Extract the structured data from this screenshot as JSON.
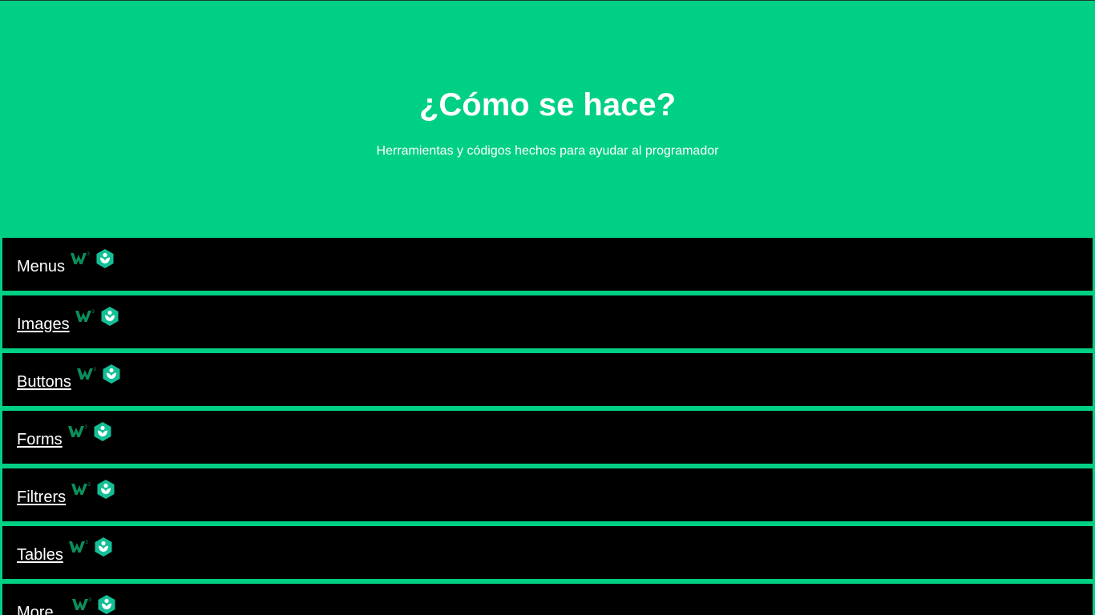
{
  "hero": {
    "title": "¿Cómo se hace?",
    "subtitle": "Herramientas y códigos hechos para ayudar al programador"
  },
  "colors": {
    "background": "#00d084",
    "row_background": "#000000",
    "text": "#ffffff",
    "w3_icon": "#0a8f5c",
    "ka_icon": "#14bf96"
  },
  "items": [
    {
      "label": "Menus",
      "link": false,
      "icons": [
        "w3schools-icon",
        "khan-academy-icon"
      ]
    },
    {
      "label": "Images",
      "link": true,
      "icons": [
        "w3schools-icon",
        "khan-academy-icon"
      ]
    },
    {
      "label": "Buttons",
      "link": true,
      "icons": [
        "w3schools-icon",
        "khan-academy-icon"
      ]
    },
    {
      "label": "Forms",
      "link": true,
      "icons": [
        "w3schools-icon",
        "khan-academy-icon"
      ]
    },
    {
      "label": "Filtrers",
      "link": true,
      "icons": [
        "w3schools-icon",
        "khan-academy-icon"
      ]
    },
    {
      "label": "Tables",
      "link": true,
      "icons": [
        "w3schools-icon",
        "khan-academy-icon"
      ]
    },
    {
      "label": "More...",
      "link": false,
      "icons": [
        "w3schools-icon",
        "khan-academy-icon"
      ]
    }
  ]
}
